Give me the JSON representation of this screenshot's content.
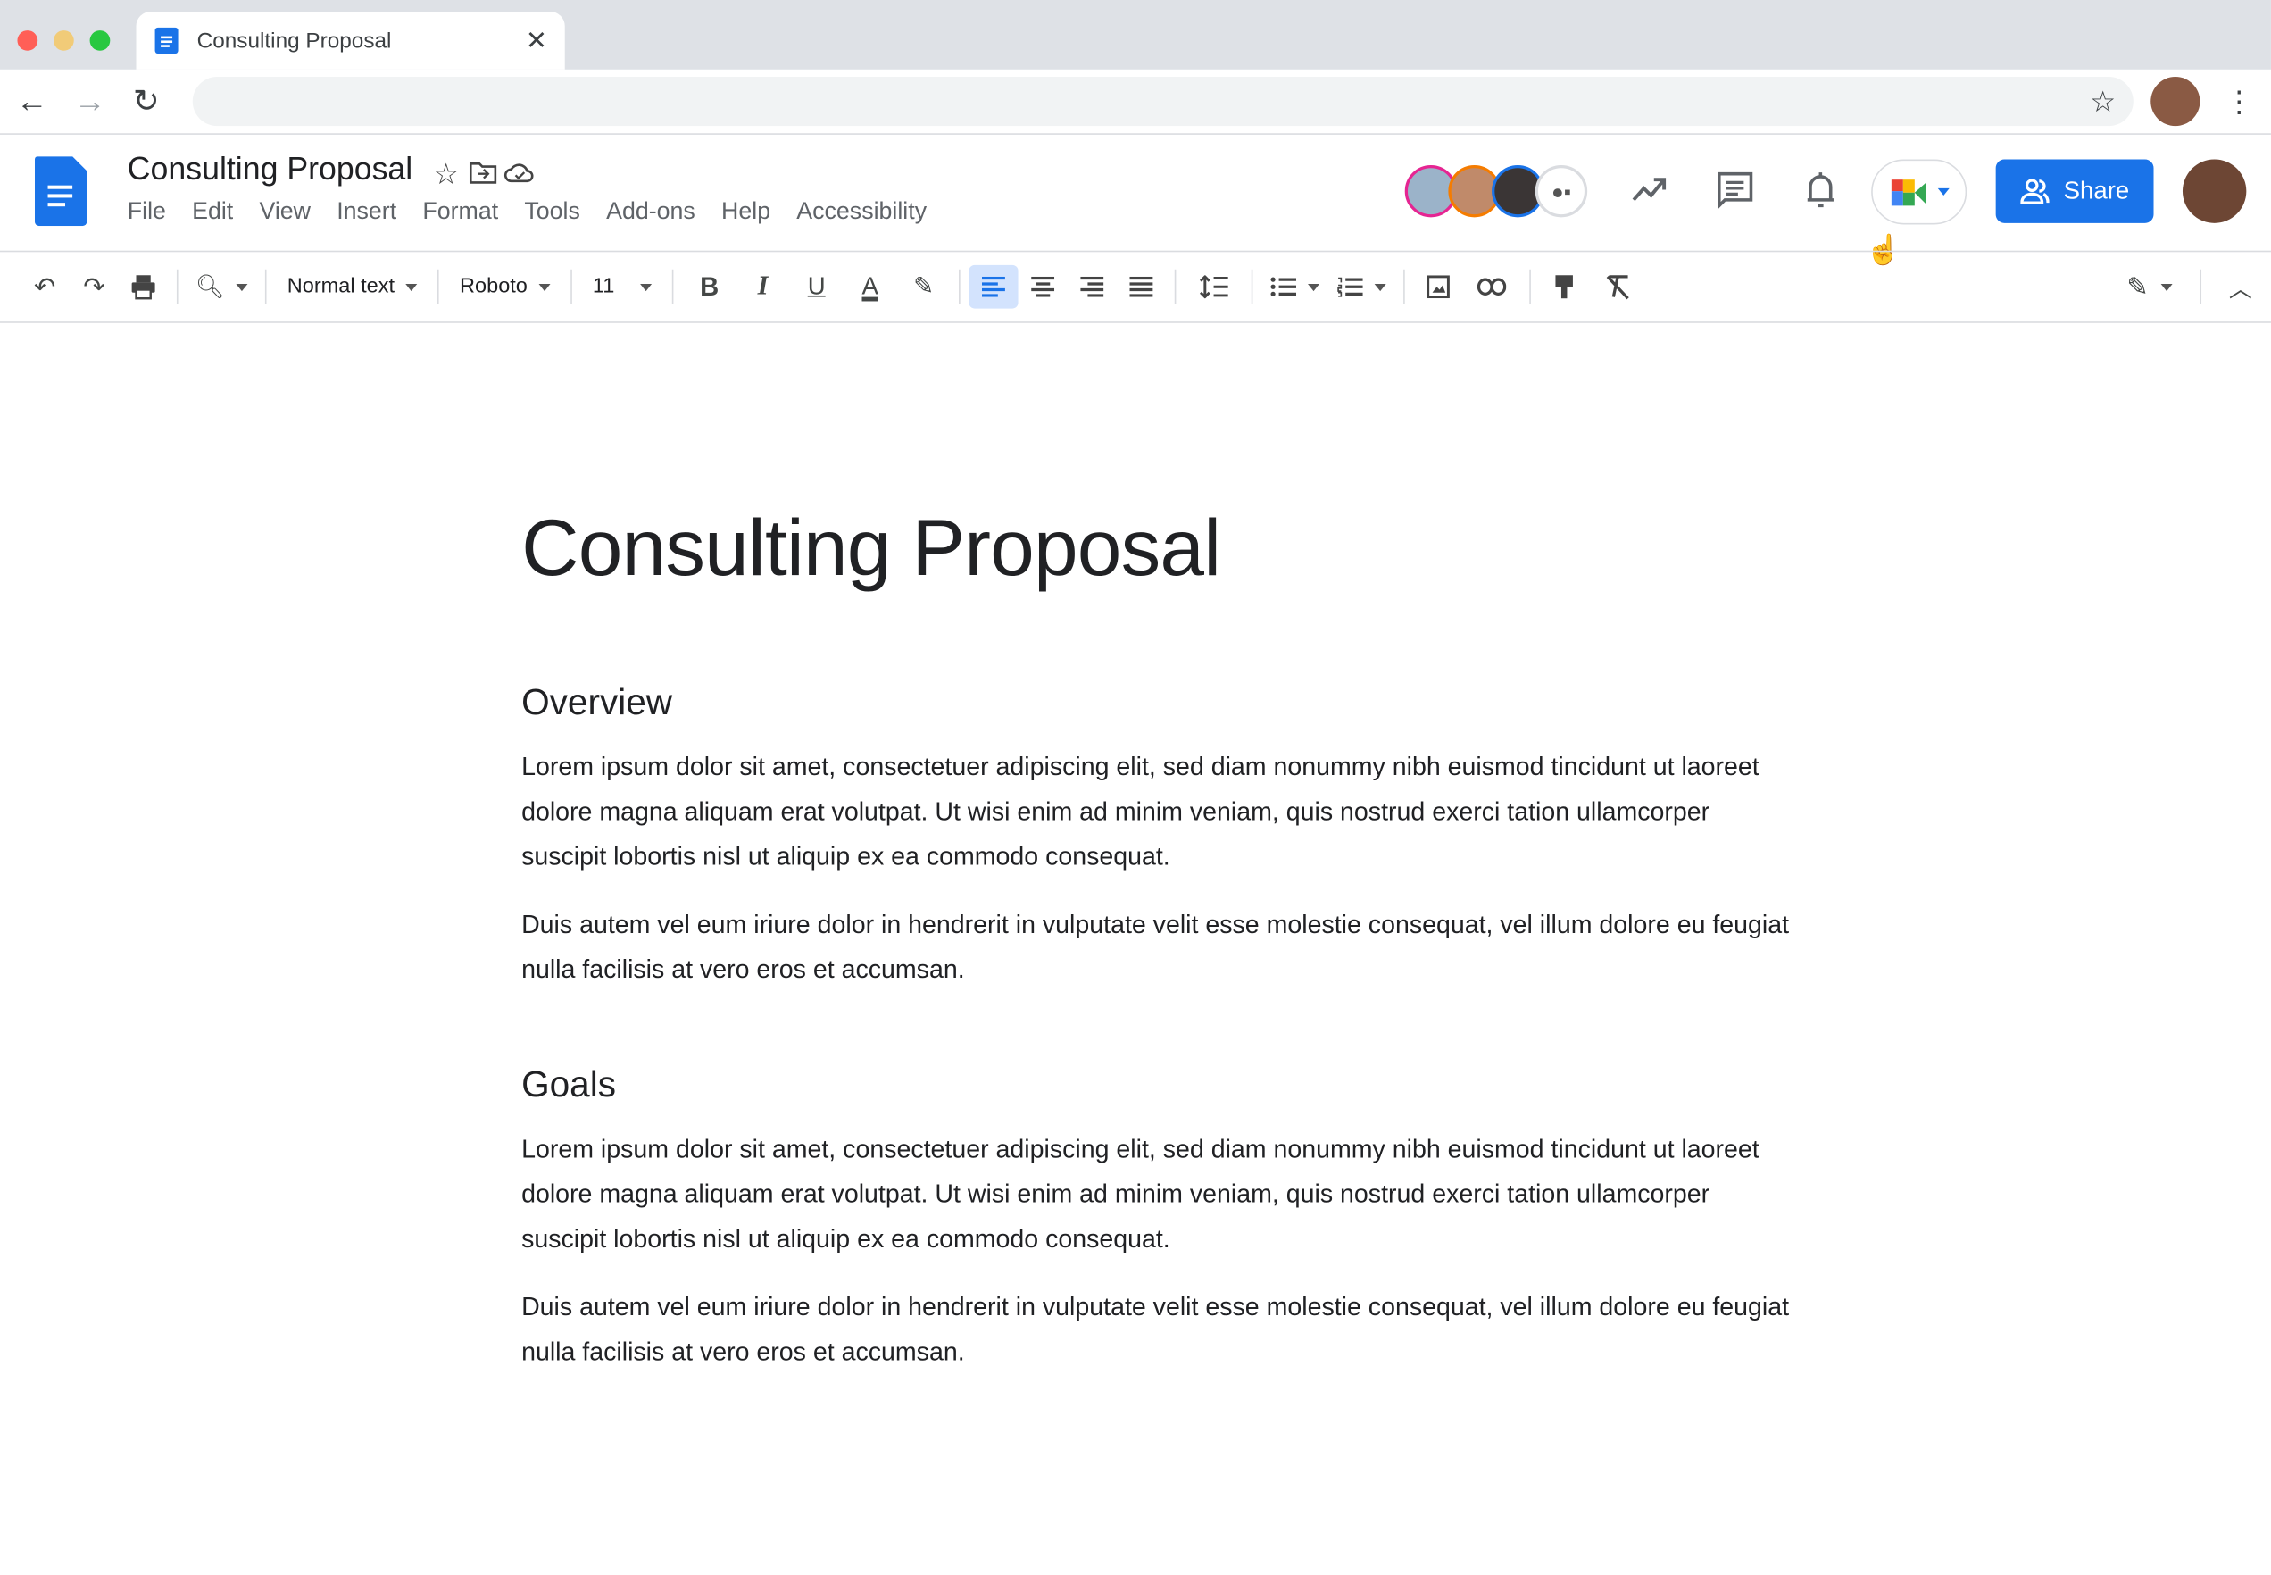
{
  "browser": {
    "tab_title": "Consulting Proposal",
    "url": ""
  },
  "doc": {
    "title": "Consulting Proposal",
    "menu": [
      "File",
      "Edit",
      "View",
      "Insert",
      "Format",
      "Tools",
      "Add-ons",
      "Help",
      "Accessibility"
    ],
    "share_label": "Share"
  },
  "toolbar": {
    "style": "Normal text",
    "font": "Roboto",
    "size": "11"
  },
  "content": {
    "heading": "Consulting Proposal",
    "sections": [
      {
        "title": "Overview",
        "paragraphs": [
          "Lorem ipsum dolor sit amet, consectetuer adipiscing elit, sed diam nonummy nibh euismod tincidunt ut laoreet dolore magna aliquam erat volutpat. Ut wisi enim ad minim veniam, quis nostrud exerci tation ullamcorper suscipit lobortis nisl ut aliquip ex ea commodo consequat.",
          "Duis autem vel eum iriure dolor in hendrerit in vulputate velit esse molestie consequat, vel illum dolore eu feugiat nulla facilisis at vero eros et accumsan."
        ]
      },
      {
        "title": "Goals",
        "paragraphs": [
          "Lorem ipsum dolor sit amet, consectetuer adipiscing elit, sed diam nonummy nibh euismod tincidunt ut laoreet dolore magna aliquam erat volutpat. Ut wisi enim ad minim veniam, quis nostrud exerci tation ullamcorper suscipit lobortis nisl ut aliquip ex ea commodo consequat.",
          "Duis autem vel eum iriure dolor in hendrerit in vulputate velit esse molestie consequat, vel illum dolore eu feugiat nulla facilisis at vero eros et accumsan."
        ]
      }
    ]
  },
  "colors": {
    "accent": "#1a73e8",
    "avatar_rings": [
      "#e52592",
      "#f57c00",
      "#1a73e8"
    ]
  }
}
